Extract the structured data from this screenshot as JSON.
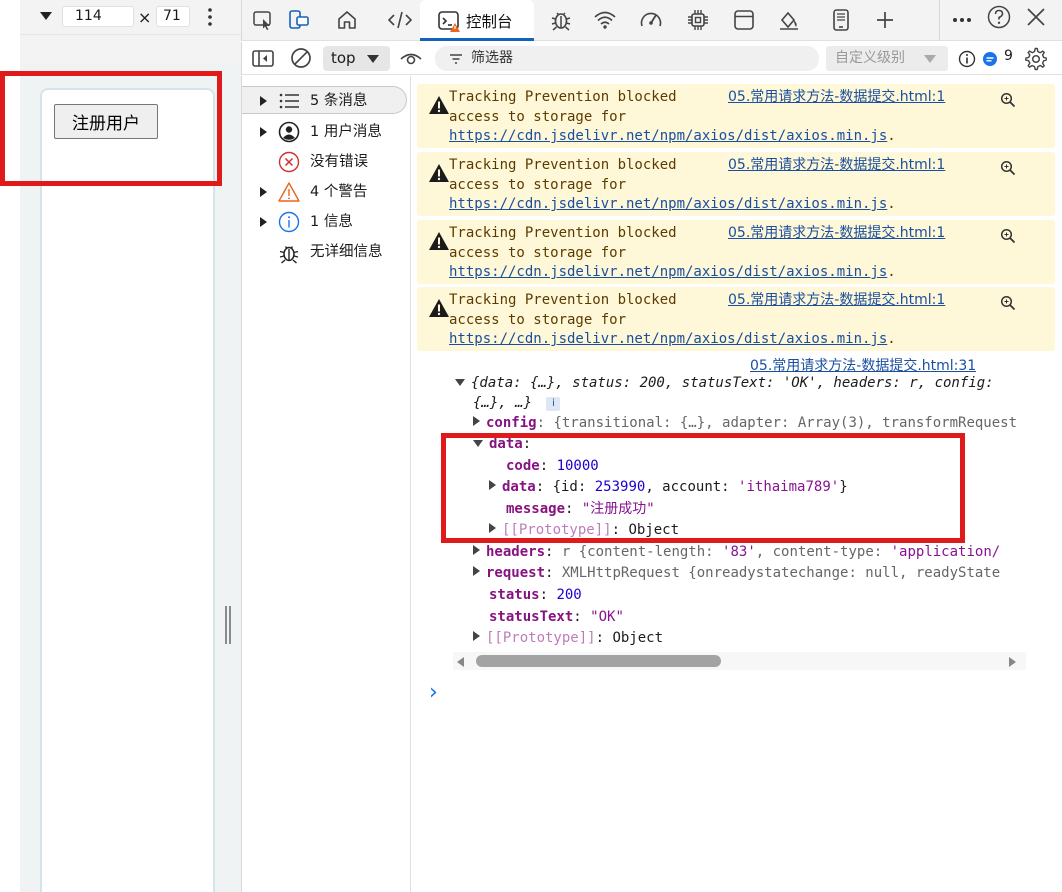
{
  "device": {
    "width": "114",
    "height": "71",
    "times": "×",
    "button_label": "注册用户"
  },
  "toolbar": {
    "console_tab_label": "控制台"
  },
  "console_bar": {
    "context": "top",
    "filter_placeholder": "筛选器",
    "levels": "自定义级别",
    "issues_count": "9"
  },
  "sidebar": {
    "items": [
      {
        "label": "5 条消息",
        "icon": "list-icon"
      },
      {
        "label": "1 用户消息",
        "icon": "user-icon"
      },
      {
        "label": "没有错误",
        "icon": "error-icon"
      },
      {
        "label": "4 个警告",
        "icon": "warning-icon"
      },
      {
        "label": "1 信息",
        "icon": "info-icon"
      },
      {
        "label": "无详细信息",
        "icon": "bug-icon"
      }
    ]
  },
  "console": {
    "warning": {
      "line1": "Tracking Prevention blocked",
      "line2": "access to storage for",
      "url": "https://cdn.jsdelivr.net/npm/axios/dist/axios.min.js",
      "url_suffix": ".",
      "source": "05.常用请求方法-数据提交.html:1"
    },
    "log_source": "05.常用请求方法-数据提交.html:31",
    "summary_1": "{data: {…}, status: 200, statusText: 'OK', headers: r, config:",
    "summary_2": "{…}, …}",
    "config_key": "config",
    "config_val": "{transitional: {…}, adapter: Array(3), transformRequest",
    "data_key": "data",
    "code_key": "code",
    "code_val": "10000",
    "inner_data_key": "data",
    "inner_data_val_1": "{id: ",
    "inner_data_id": "253990",
    "inner_data_val_2": ", account: ",
    "inner_data_account": "'ithaima789'",
    "inner_data_val_3": "}",
    "message_key": "message",
    "message_val": "\"注册成功\"",
    "proto_key": "[[Prototype]]",
    "proto_val": "Object",
    "headers_key": "headers",
    "headers_val_1": "r {content-length: ",
    "headers_cl": "'83'",
    "headers_val_2": ", content-type: ",
    "headers_ct": "'application/",
    "request_key": "request",
    "request_val": "XMLHttpRequest {onreadystatechange: null, readyState",
    "status_key": "status",
    "status_val": "200",
    "statustext_key": "statusText",
    "statustext_val": "\"OK\"",
    "prompt": "›"
  },
  "colors": {
    "warning_bg": "#fef7d8",
    "accent": "#1463b8",
    "highlight": "#e0191b"
  }
}
